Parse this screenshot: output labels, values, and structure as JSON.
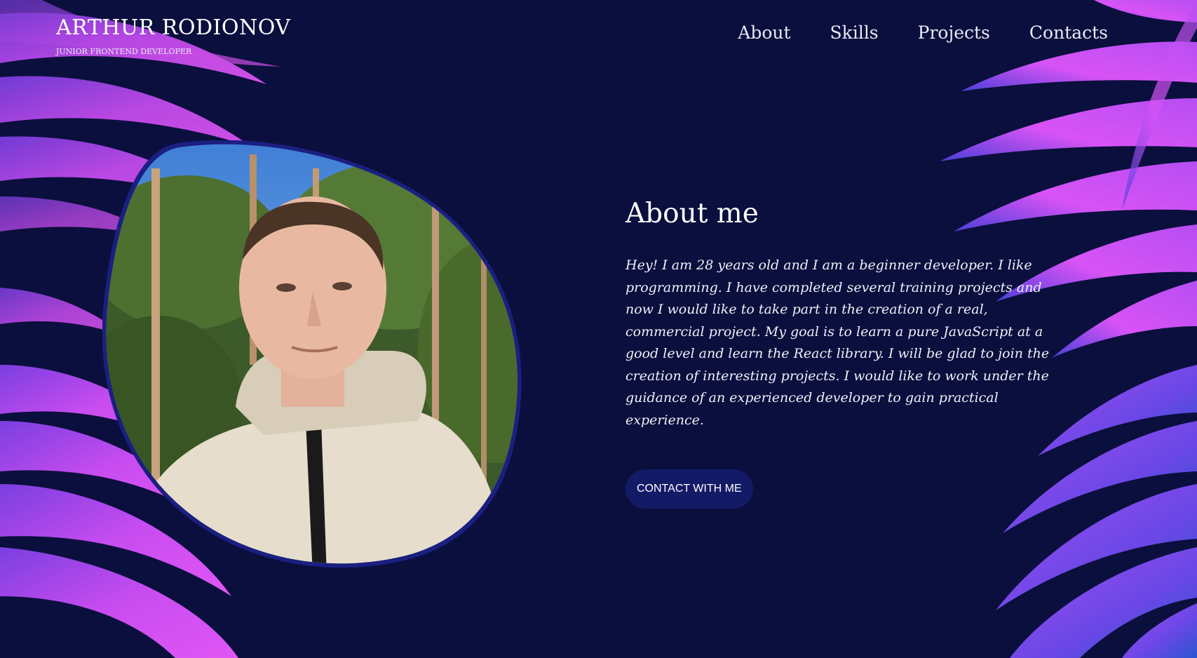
{
  "brand": {
    "name": "ARTHUR RODIONOV",
    "subtitle": "JUNIOR FRONTEND DEVELOPER"
  },
  "nav": {
    "items": [
      "About",
      "Skills",
      "Projects",
      "Contacts"
    ]
  },
  "about": {
    "title": "About me",
    "text": "Hey! I am 28 years old and I am a beginner developer. I like programming. I have completed several training projects and now I would like to take part in the creation of a real, commercial project. My goal is to learn a pure JavaScript at a good level and learn the React library. I will be glad to join the creation of interesting projects. I would like to work under the guidance of an experienced developer to gain practical experience.",
    "button_label": "CONTACT WITH ME"
  },
  "colors": {
    "background": "#0b0f3d",
    "leaf_pink": "#d64cf0",
    "leaf_violet": "#7a3fe0",
    "leaf_blue": "#2a4fc8",
    "button_bg": "#131a66"
  }
}
